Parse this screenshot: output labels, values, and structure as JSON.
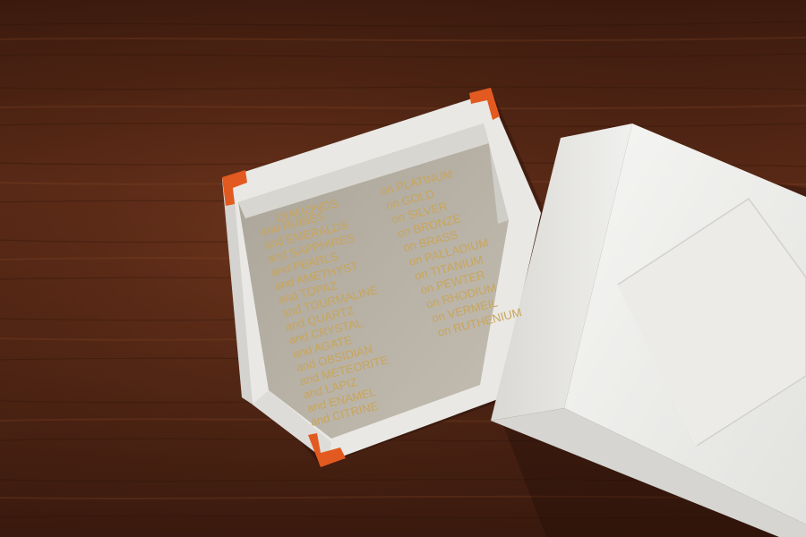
{
  "colors": {
    "wood_dark": "#3d1c10",
    "wood_mid": "#5a2b18",
    "wood_light": "#7a3e22",
    "box_white": "#eeeeec",
    "box_shadow": "#c9c8c4",
    "interior_grey": "#b9b3a8",
    "corner_orange": "#e35a21",
    "gold_foil": "#c9a55a"
  },
  "box_interior": {
    "left_column": [
      "DIAMONDS",
      "and RUBIES",
      "and EMERALDS",
      "and SAPPHIRES",
      "and PEARLS",
      "and AMETHYST",
      "and TOPAZ",
      "and TOURMALINE",
      "and QUARTZ",
      "and CRYSTAL",
      "and AGATE",
      "and OBSIDIAN",
      "and METEORITE",
      "and LAPIZ",
      "and ENAMEL",
      "and CITRINE"
    ],
    "right_column": [
      "on PLATINUM",
      "on GOLD",
      "on SILVER",
      "on BRONZE",
      "on BRASS",
      "on PALLADIUM",
      "on TITANIUM",
      "on PEWTER",
      "on RHODIUM",
      "on VERMEIL",
      "on RUTHENIUM"
    ]
  }
}
